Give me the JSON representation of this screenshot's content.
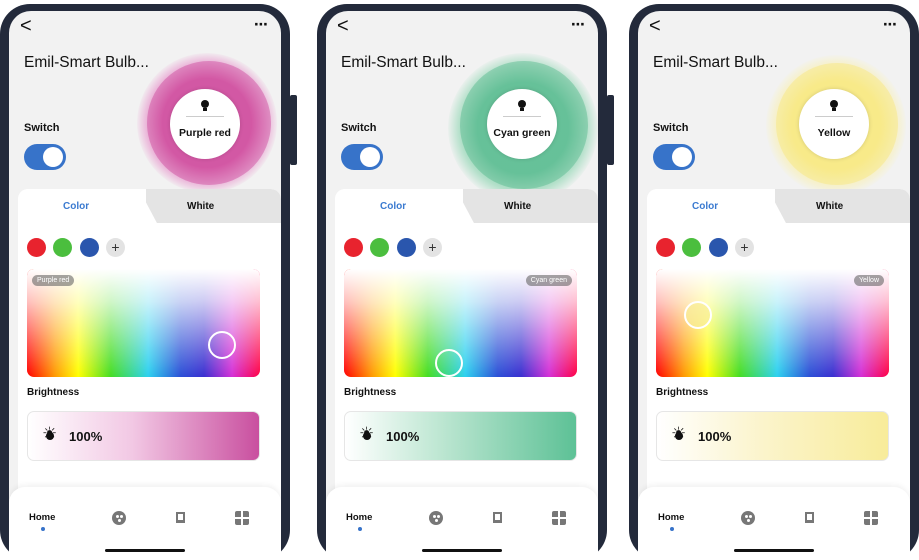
{
  "header": {
    "back_glyph": "<",
    "more_glyph": "⋯"
  },
  "device": {
    "name": "Emil-Smart Bulb..."
  },
  "switch": {
    "label": "Switch",
    "on": true
  },
  "tabs": {
    "color": "Color",
    "white": "White"
  },
  "swatches": {
    "colors": [
      "#e8232e",
      "#4bbe3e",
      "#2a56ad"
    ],
    "add_label": "+"
  },
  "brightness": {
    "label": "Brightness",
    "value": "100%"
  },
  "nav": {
    "home_label": "Home",
    "icons": [
      "palette-icon",
      "music-icon",
      "grid-icon"
    ]
  },
  "phones": [
    {
      "color_name": "Purple red",
      "accent": "#c94f9f"
    },
    {
      "color_name": "Cyan green",
      "accent": "#5dc196"
    },
    {
      "color_name": "Yellow",
      "accent": "#f8ec9a"
    }
  ]
}
